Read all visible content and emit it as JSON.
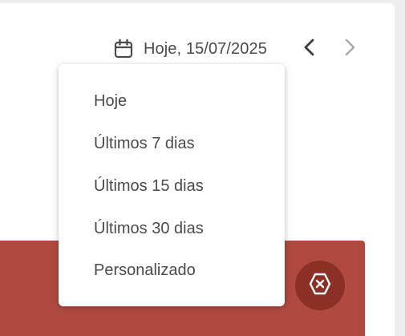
{
  "header": {
    "date_label": "Hoje, 15/07/2025",
    "icons": {
      "calendar": "calendar-icon",
      "prev": "chevron-left-icon",
      "next": "chevron-right-icon"
    }
  },
  "dropdown": {
    "items": [
      {
        "label": "Hoje"
      },
      {
        "label": "Últimos 7 dias"
      },
      {
        "label": "Últimos 15 dias"
      },
      {
        "label": "Últimos 30 dias"
      },
      {
        "label": "Personalizado"
      }
    ]
  },
  "banner": {
    "color": "#b04a40",
    "button_color": "#8c2f26",
    "button_icon": "close-hexagon-icon"
  },
  "colors": {
    "text": "#4a4a4a",
    "background": "#eeeeee",
    "card": "#ffffff"
  }
}
